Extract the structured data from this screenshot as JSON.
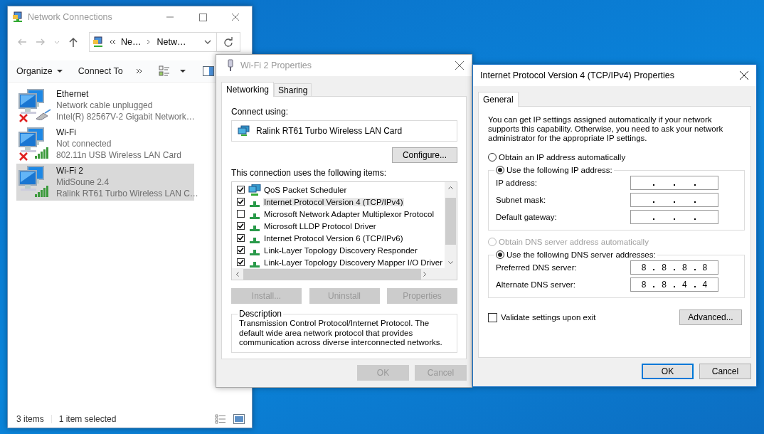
{
  "network_connections": {
    "title": "Network Connections",
    "active": false,
    "address_bar": {
      "segments": [
        "Ne…",
        "Netw…"
      ]
    },
    "toolbar": {
      "organize": "Organize",
      "connect_to": "Connect To"
    },
    "items": [
      {
        "name": "Ethernet",
        "status": "Network cable unplugged",
        "device": "Intel(R) 82567V-2 Gigabit Network…",
        "kind": "ethernet",
        "connected": false,
        "selected": false
      },
      {
        "name": "Wi-Fi",
        "status": "Not connected",
        "device": "802.11n USB Wireless LAN Card",
        "kind": "wifi",
        "connected": false,
        "selected": false
      },
      {
        "name": "Wi-Fi 2",
        "status": "MidSoune 2.4",
        "device": "Ralink RT61 Turbo Wireless LAN C…",
        "kind": "wifi",
        "connected": true,
        "selected": true
      }
    ],
    "status_bar": {
      "count": "3 items",
      "selection": "1 item selected"
    }
  },
  "wifi_properties": {
    "title": "Wi-Fi 2 Properties",
    "active": false,
    "tabs": [
      {
        "label": "Networking",
        "selected": true
      },
      {
        "label": "Sharing",
        "selected": false
      }
    ],
    "connect_using": "Connect using:",
    "adapter": "Ralink RT61 Turbo Wireless LAN Card",
    "configure": "Configure...",
    "items_label": "This connection uses the following items:",
    "components": [
      {
        "label": "QoS Packet Scheduler",
        "kind": "service",
        "checked": true,
        "selected": false
      },
      {
        "label": "Internet Protocol Version 4 (TCP/IPv4)",
        "kind": "protocol",
        "checked": true,
        "selected": true
      },
      {
        "label": "Microsoft Network Adapter Multiplexor Protocol",
        "kind": "protocol",
        "checked": false,
        "selected": false
      },
      {
        "label": "Microsoft LLDP Protocol Driver",
        "kind": "protocol",
        "checked": true,
        "selected": false
      },
      {
        "label": "Internet Protocol Version 6 (TCP/IPv6)",
        "kind": "protocol",
        "checked": true,
        "selected": false
      },
      {
        "label": "Link-Layer Topology Discovery Responder",
        "kind": "protocol",
        "checked": true,
        "selected": false
      },
      {
        "label": "Link-Layer Topology Discovery Mapper I/O Driver",
        "kind": "protocol",
        "checked": true,
        "selected": false
      }
    ],
    "actions": [
      {
        "label": "Install...",
        "disabled": true
      },
      {
        "label": "Uninstall",
        "disabled": true
      },
      {
        "label": "Properties",
        "disabled": true
      }
    ],
    "description": {
      "title": "Description",
      "text": "Transmission Control Protocol/Internet Protocol. The default wide area network protocol that provides communication across diverse interconnected networks."
    },
    "buttons": [
      {
        "label": "OK",
        "disabled": true
      },
      {
        "label": "Cancel",
        "disabled": true
      }
    ]
  },
  "ipv4_properties": {
    "title": "Internet Protocol Version 4 (TCP/IPv4) Properties",
    "active": true,
    "tabs": [
      {
        "label": "General",
        "selected": true
      }
    ],
    "intro": "You can get IP settings assigned automatically if your network supports this capability. Otherwise, you need to ask your network administrator for the appropriate IP settings.",
    "ip_options": [
      {
        "label": "Obtain an IP address automatically",
        "selected": false,
        "disabled": false
      },
      {
        "label": "Use the following IP address:",
        "selected": true,
        "disabled": false
      }
    ],
    "ip_fields": [
      {
        "label": "IP address:"
      },
      {
        "label": "Subnet mask:"
      },
      {
        "label": "Default gateway:"
      }
    ],
    "dns_options": [
      {
        "label": "Obtain DNS server address automatically",
        "selected": false,
        "disabled": true
      },
      {
        "label": "Use the following DNS server addresses:",
        "selected": true,
        "disabled": false
      }
    ],
    "dns_fields": [
      {
        "label": "Preferred DNS server:",
        "octets": [
          "8",
          "8",
          "8",
          "8"
        ]
      },
      {
        "label": "Alternate DNS server:",
        "octets": [
          "8",
          "8",
          "4",
          "4"
        ]
      }
    ],
    "validate": {
      "label": "Validate settings upon exit",
      "checked": false
    },
    "advanced": "Advanced...",
    "buttons": [
      {
        "label": "OK",
        "default": true
      },
      {
        "label": "Cancel",
        "default": false
      }
    ]
  }
}
